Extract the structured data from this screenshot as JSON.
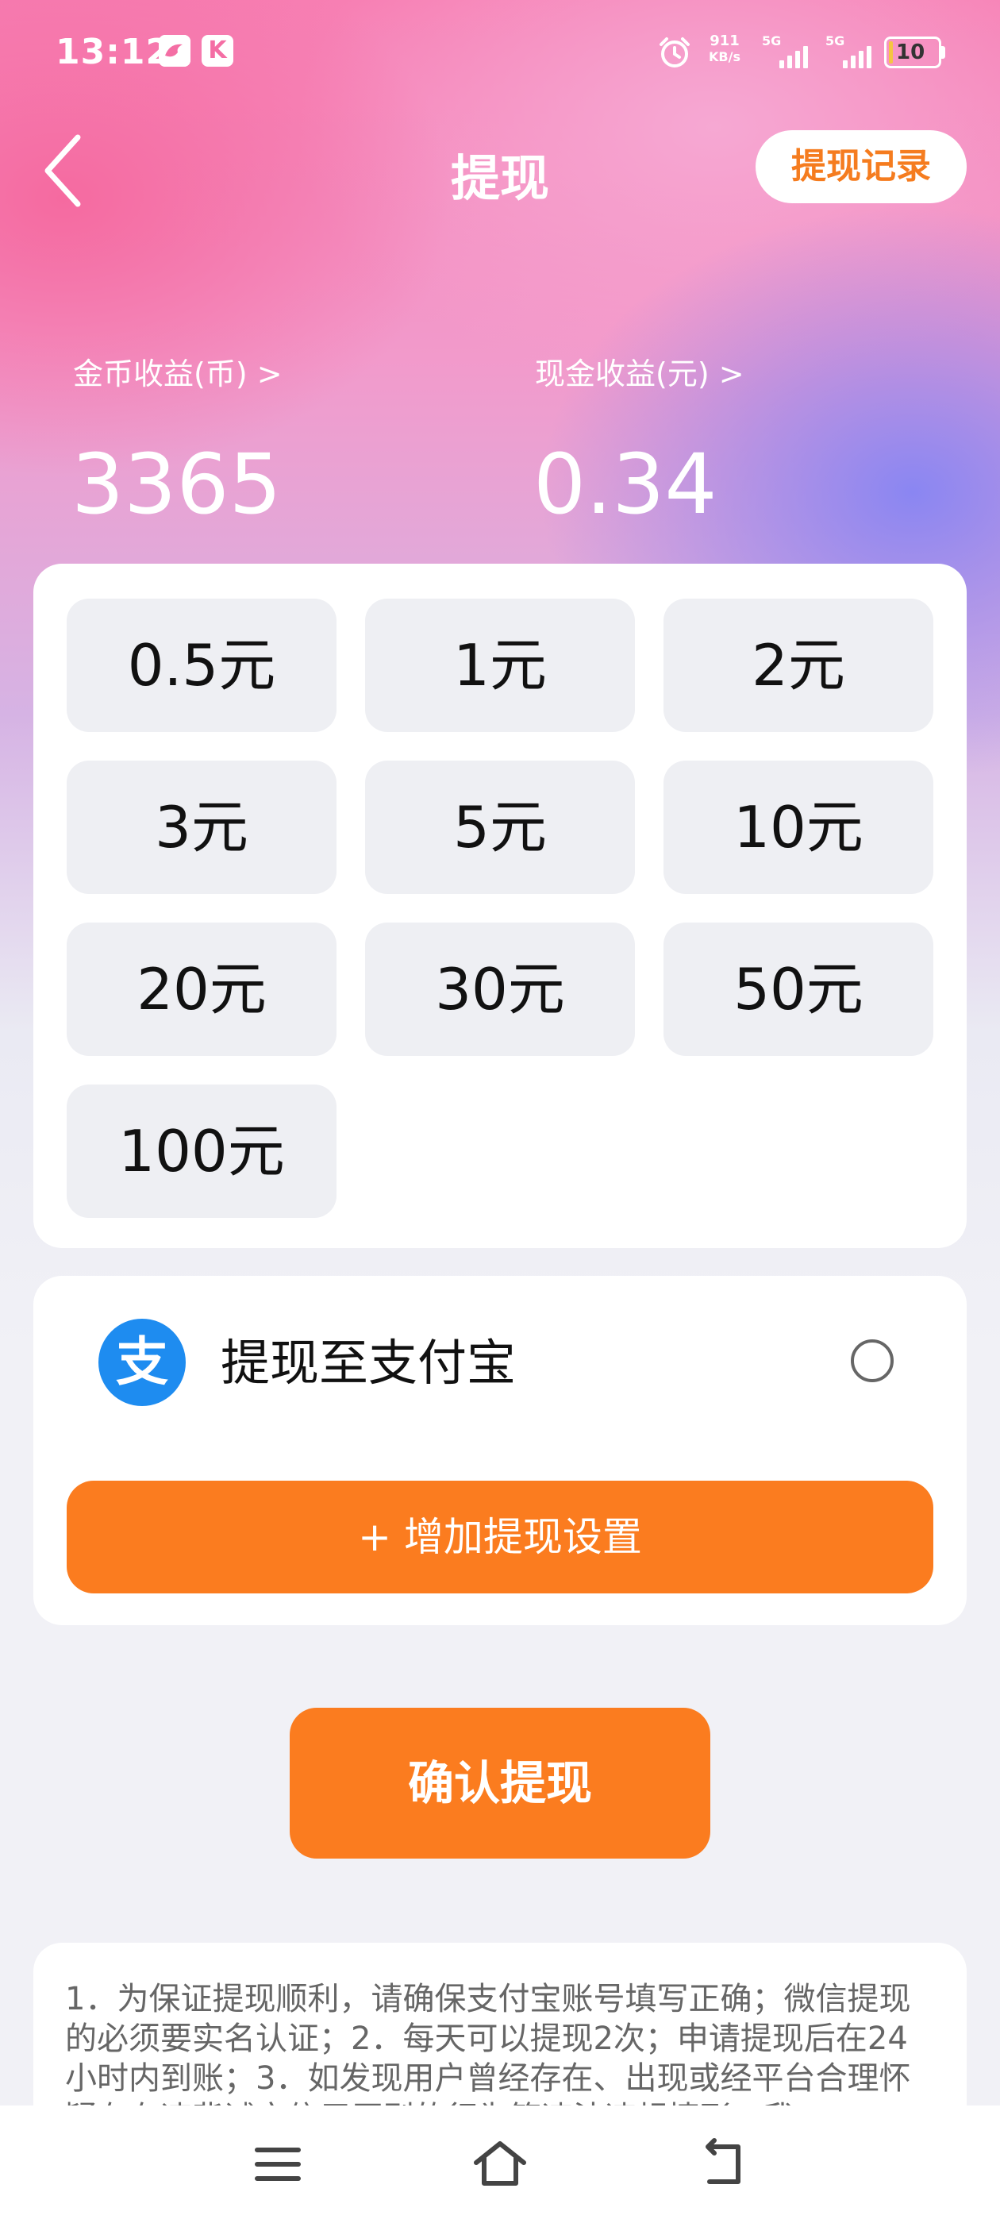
{
  "status_bar": {
    "time": "13:12",
    "app_icon_1": "bird-icon",
    "app_icon_2_letter": "K",
    "alarm_icon": "alarm-clock-icon",
    "net_speed_value": "911",
    "net_speed_unit": "KB/s",
    "sim1_label": "5G",
    "sim2_label": "5G",
    "battery": "10"
  },
  "header": {
    "back_icon": "chevron-left-icon",
    "title": "提现",
    "record_button": "提现记录"
  },
  "stats": {
    "coin_label": "金币收益(币) >",
    "coin_value": "3365",
    "cash_label": "现金收益(元) >",
    "cash_value": "0.34"
  },
  "amounts": [
    "0.5元",
    "1元",
    "2元",
    "3元",
    "5元",
    "10元",
    "20元",
    "30元",
    "50元",
    "100元"
  ],
  "payment": {
    "alipay_logo_char": "支",
    "alipay_label": "提现至支付宝",
    "add_button": "+ 增加提现设置"
  },
  "confirm_button": "确认提现",
  "notice": "1．为保证提现顺利，请确保支付宝账号填写正确；微信提现的必须要实名认证；2．每天可以提现2次；申请提现后在24小时内到账；3．如发现用户曾经存在、出现或经平台合理怀疑存在违背诚实信用原则的行为等违法违规情形，我",
  "colors": {
    "accent": "#fb7c1f",
    "alipay": "#1e8cf0"
  }
}
